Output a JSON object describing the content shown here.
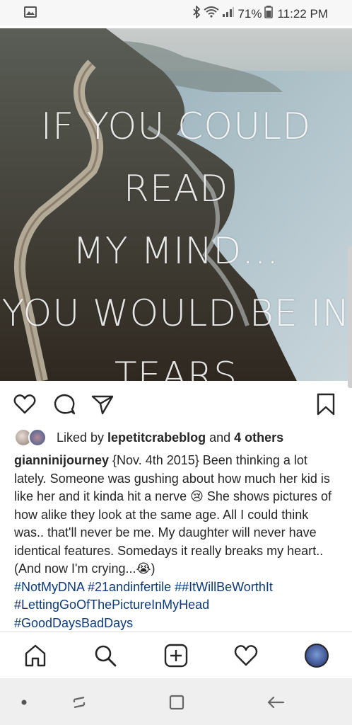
{
  "status_bar": {
    "battery": "71%",
    "time": "11:22 PM",
    "icons": [
      "image-icon",
      "bluetooth-icon",
      "wifi-icon",
      "signal-icon",
      "battery-icon"
    ]
  },
  "post": {
    "image_quote_lines": [
      "IF YOU COULD READ",
      "MY MIND...",
      "YOU WOULD BE IN",
      "TEARS"
    ],
    "actions": [
      "heart-icon",
      "comment-icon",
      "share-icon",
      "bookmark-icon"
    ],
    "likes": {
      "prefix": "Liked by ",
      "user": "lepetitcrabeblog",
      "middle": " and ",
      "others": "4 others"
    },
    "caption": {
      "username": "gianninijourney",
      "text": " {Nov. 4th 2015} Been thinking a lot lately. Someone was gushing about how much her kid is like her and it kinda hit a nerve 😢 She shows pictures of how alike they look at the same age.  All I could think was.. that'll never be me. My daughter will never have identical features. Somedays it really breaks my heart.. (And now I'm crying...😭)",
      "hashtags": [
        "#NotMyDNA #21andinfertile ##ItWillBeWorthIt",
        "#LettingGoOfThePictureInMyHead",
        "#GoodDaysBadDays"
      ]
    }
  },
  "bottom_nav": [
    "home-icon",
    "search-icon",
    "new-post-icon",
    "activity-icon",
    "profile-avatar"
  ],
  "system_nav": [
    "dot-icon",
    "recent-apps-icon",
    "home-button-icon",
    "back-icon"
  ],
  "colors": {
    "hashtag": "#0d3a7a",
    "text": "#262626"
  }
}
